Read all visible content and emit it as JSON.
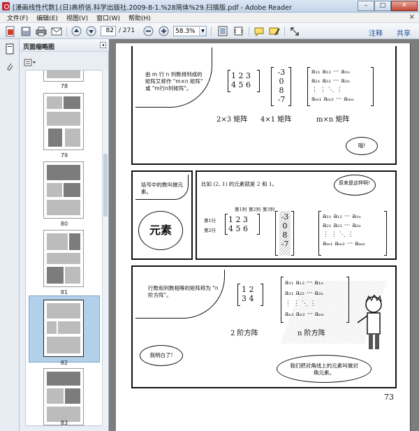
{
  "window": {
    "title": "[漫画线性代数].(日)高桥信.科学出版社.2009-8-1.%28简体%29.扫描版.pdf - Adobe Reader",
    "controls": [
      "–",
      "□",
      "✕"
    ]
  },
  "menu": {
    "items": [
      "文件(F)",
      "编辑(E)",
      "视图(V)",
      "窗口(W)",
      "帮助(H)"
    ],
    "close": "×"
  },
  "toolbar": {
    "page_current": "82",
    "page_total": "/ 271",
    "zoom": "58.3%",
    "annotate": "注释",
    "share": "共享"
  },
  "panel": {
    "title": "页面缩略图",
    "collapse": "◂",
    "thumbnails": [
      {
        "label": "78"
      },
      {
        "label": "79"
      },
      {
        "label": "80"
      },
      {
        "label": "81"
      },
      {
        "label": "82",
        "selected": true
      },
      {
        "label": "83"
      }
    ]
  },
  "document": {
    "top_panel": {
      "note": "由 m 行 n 列数排列成的矩阵又称作 \"m×n 矩阵\" 或 \"m行n列矩阵\"。",
      "label_23": "2×3 矩阵",
      "label_41": "4×1 矩阵",
      "label_mn": "m×n 矩阵",
      "exclaim": "哦!",
      "matrix_23": [
        "1 2 3",
        "4 5 6"
      ],
      "matrix_41": [
        "-3",
        "0",
        "8",
        "-7"
      ],
      "matrix_mn": [
        "a₁₁  a₁₂  ···  a₁ₙ",
        "a₂₁  a₂₂  ···  a₂ₙ",
        "⋮      ⋮     ⋱    ⋮",
        "aₘ₁  aₘ₂  ···  aₘₙ"
      ]
    },
    "middle_panel": {
      "note": "括号中的数叫做元素。",
      "element_word": "元素",
      "example": "比如 (2, 1) 的元素就是 2 和 1。",
      "reply": "原来是这样啊!",
      "col1": "第1列",
      "col2": "第2列",
      "col3": "第3列",
      "row1": "第1行",
      "row2": "第2行",
      "matrix_23": [
        "1 2 3",
        "4 5 6"
      ],
      "matrix_41": [
        "-3",
        "0",
        "8",
        "-7"
      ],
      "matrix_mn": [
        "a₁₁  a₁₂  ···  a₁ₙ",
        "a₂₁  a₂₂  ···  a₂ₙ",
        "⋮      ⋮     ⋱    ⋮",
        "aₘ₁  aₘ₂  ···  aₘₙ"
      ]
    },
    "bottom_panel": {
      "note": "行数和列数相等的矩阵称为 \"n 阶方阵\"。",
      "label_2": "2 阶方阵",
      "label_n": "n 阶方阵",
      "understood": "我明白了!",
      "diagonal": "我们把对角线上的元素叫做对角元素。",
      "matrix_2": [
        "1  2",
        "3  4"
      ],
      "matrix_n": [
        "a₁₁  a₁₂  ···  a₁ₙ",
        "a₂₁  a₂₂  ···  a₂ₙ",
        "⋮      ⋮     ⋱    ⋮",
        "aₙ₁  aₙ₂  ···  aₙₙ"
      ]
    },
    "page_number": "73"
  }
}
